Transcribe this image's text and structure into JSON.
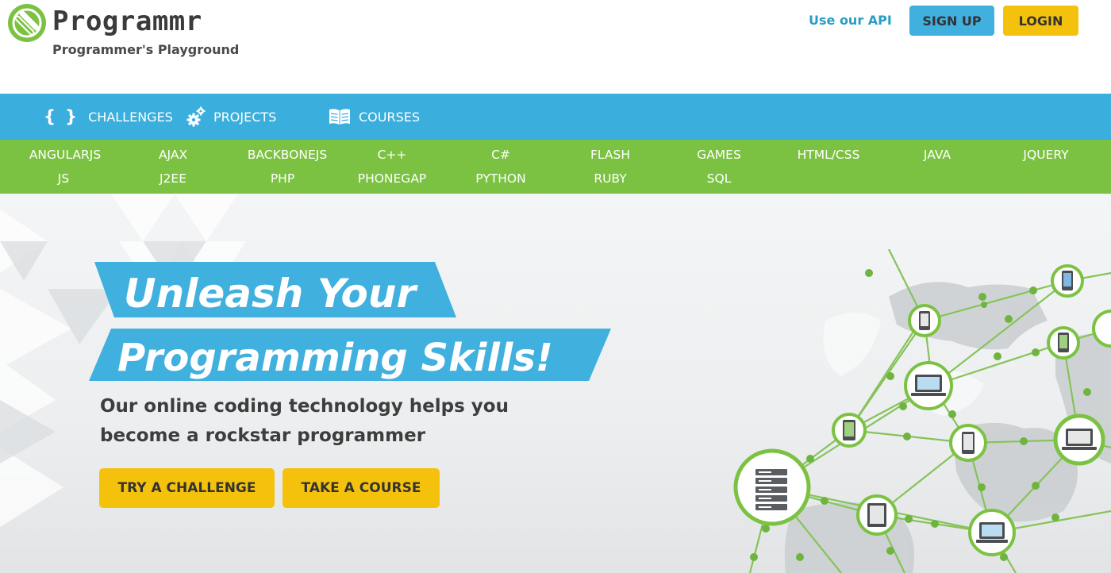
{
  "brand": {
    "name": "Programmr",
    "tagline": "Programmer's Playground",
    "logo_icon": "programmr-logo-icon",
    "color": "#7cc242"
  },
  "header": {
    "api_link": "Use our API",
    "signup": "SIGN UP",
    "login": "LOGIN"
  },
  "nav": {
    "items": [
      {
        "label": "CHALLENGES",
        "icon": "braces-icon"
      },
      {
        "label": "PROJECTS",
        "icon": "gears-icon"
      },
      {
        "label": "COURSES",
        "icon": "book-icon"
      }
    ]
  },
  "technologies": {
    "row1": [
      "ANGULARJS",
      "AJAX",
      "BACKBONEJS",
      "C++",
      "C#",
      "FLASH",
      "GAMES",
      "HTML/CSS",
      "JAVA",
      "JQUERY"
    ],
    "row2": [
      "JS",
      "J2EE",
      "PHP",
      "PHONEGAP",
      "PYTHON",
      "RUBY",
      "SQL"
    ]
  },
  "hero": {
    "headline_line1": "Unleash Your",
    "headline_line2": "Programming Skills!",
    "subtext_line1": "Our online coding technology helps you",
    "subtext_line2": "become a rockstar programmer",
    "cta_challenge": "TRY A CHALLENGE",
    "cta_course": "TAKE A COURSE"
  },
  "colors": {
    "blue": "#3aaedd",
    "green": "#7cc242",
    "yellow": "#f4c20d",
    "link": "#2a9dc4"
  }
}
